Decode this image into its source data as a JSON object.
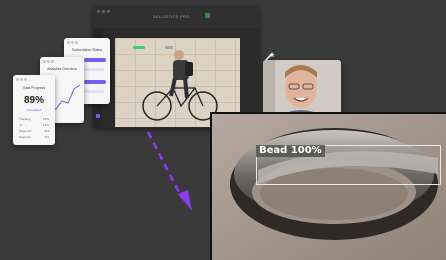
{
  "editor": {
    "title": "BALLISTICS PRO",
    "sidebar_icons": [
      "layers-icon",
      "brush-icon",
      "crop-icon",
      "adjust-icon",
      "magic-icon"
    ]
  },
  "card_performance": {
    "title": "Total Progress",
    "value": "89%",
    "subtitle": "Completed",
    "rows": [
      {
        "label": "Tracking",
        "value": "23%"
      },
      {
        "label": "AI",
        "value": "12%"
      },
      {
        "label": "Object ID",
        "value": "8%"
      },
      {
        "label": "Segment",
        "value": "5%"
      }
    ]
  },
  "card_analytics": {
    "title": "Analytics Overview"
  },
  "card_tasks": {
    "title": "Subscription Status"
  },
  "detection": {
    "label": "Bead 100%",
    "colors": {
      "box": "#e8e8e8",
      "label_bg": "#505050"
    }
  },
  "accent": "#7c5cf0",
  "arrow_color": "#8a3cf0"
}
